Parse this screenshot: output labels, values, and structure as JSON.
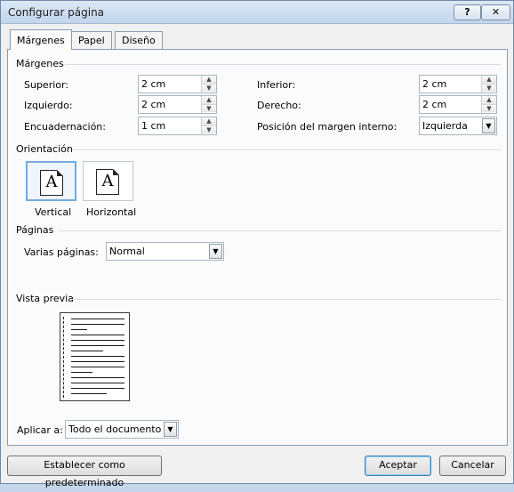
{
  "window": {
    "title": "Configurar página",
    "help_label": "?",
    "close_label": "✕"
  },
  "tabs": [
    {
      "label": "Márgenes",
      "active": true
    },
    {
      "label": "Papel",
      "active": false
    },
    {
      "label": "Diseño",
      "active": false
    }
  ],
  "margins": {
    "group_label": "Márgenes",
    "superior": {
      "label": "Superior:",
      "value": "2 cm"
    },
    "izquierdo": {
      "label": "Izquierdo:",
      "value": "2 cm"
    },
    "encuadernacion": {
      "label": "Encuadernación:",
      "value": "1 cm"
    },
    "inferior": {
      "label": "Inferior:",
      "value": "2 cm"
    },
    "derecho": {
      "label": "Derecho:",
      "value": "2 cm"
    },
    "posicion": {
      "label": "Posición del margen interno:",
      "value": "Izquierda"
    }
  },
  "orientation": {
    "group_label": "Orientación",
    "vertical": {
      "label": "Vertical",
      "icon_letter": "A",
      "selected": true
    },
    "horizontal": {
      "label": "Horizontal",
      "icon_letter": "A",
      "selected": false
    }
  },
  "pages": {
    "group_label": "Páginas",
    "multiple_label": "Varias páginas:",
    "multiple_value": "Normal"
  },
  "preview": {
    "group_label": "Vista previa",
    "apply_label": "Aplicar a:",
    "apply_value": "Todo el documento"
  },
  "buttons": {
    "set_default": "Establecer como predeterminado",
    "ok": "Aceptar",
    "cancel": "Cancelar"
  }
}
